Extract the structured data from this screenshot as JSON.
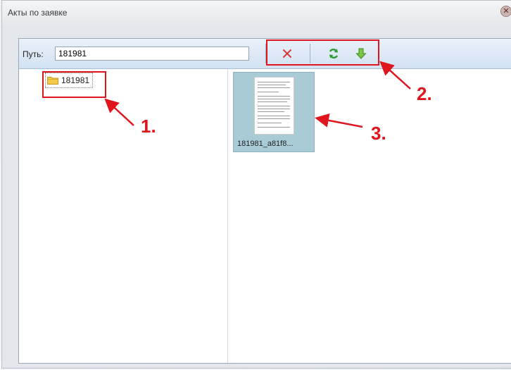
{
  "window": {
    "title": "Акты по заявке"
  },
  "toolbar": {
    "path_label": "Путь:",
    "path_value": "181981"
  },
  "tree": {
    "root_label": "181981"
  },
  "files": [
    {
      "name": "181981_a81f8..."
    }
  ],
  "annotations": {
    "one": "1.",
    "two": "2.",
    "three": "3."
  },
  "colors": {
    "annotation": "#e0141c",
    "selected_file": "#a9cbd6"
  }
}
